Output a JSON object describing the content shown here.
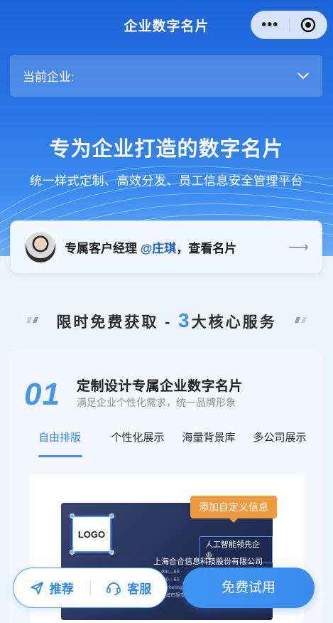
{
  "nav": {
    "title": "企业数字名片",
    "more_icon": "more-dots-icon",
    "close_icon": "target-icon"
  },
  "company_selector": {
    "label": "当前企业:",
    "icon": "chevron-down-icon"
  },
  "hero": {
    "headline": "专为企业打造的数字名片",
    "subline": "统一样式定制、高效分发、员工信息安全管理平台"
  },
  "manager": {
    "prefix": "专属客户经理 ",
    "name": "@庄琪",
    "suffix": "，查看名片",
    "arrow_icon": "arrow-right-icon"
  },
  "section": {
    "title_prefix": "限时免费获取 - ",
    "number": "3",
    "title_suffix": "大核心服务"
  },
  "feature": {
    "number": "01",
    "title": "定制设计专属企业数字名片",
    "subtitle": "满足企业个性化需求，统一品牌形象",
    "tabs": [
      {
        "label": "自由排版",
        "active": true
      },
      {
        "label": "个性化展示",
        "active": false
      },
      {
        "label": "海量背景库",
        "active": false
      },
      {
        "label": "多公司展示",
        "active": false
      }
    ],
    "preview": {
      "logo": "LOGO",
      "tag": "人工智能领先企业",
      "company": "上海合合信息科技股份有限公司",
      "lines": [
        "400—60",
        "400—60",
        "Marketing",
        "上海市静安区"
      ],
      "custom_tag": "添加自定义信息"
    }
  },
  "bottom": {
    "recommend": "推荐",
    "service": "客服",
    "trial": "免费试用"
  },
  "colors": {
    "primary": "#2f86ea",
    "orange": "#f09a3e"
  }
}
